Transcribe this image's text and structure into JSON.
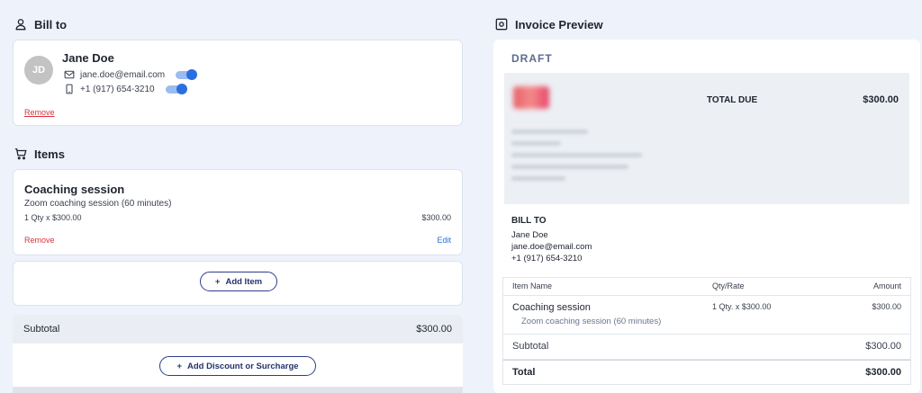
{
  "bill_to": {
    "heading": "Bill to",
    "customer": {
      "initials": "JD",
      "name": "Jane Doe",
      "email": "jane.doe@email.com",
      "phone": "+1 (917) 654-3210",
      "email_toggle_on": true,
      "phone_toggle_on": true
    },
    "remove_label": "Remove"
  },
  "items": {
    "heading": "Items",
    "list": [
      {
        "title": "Coaching session",
        "description": "Zoom coaching session (60 minutes)",
        "qty_rate": "1 Qty x $300.00",
        "amount": "$300.00",
        "remove_label": "Remove",
        "edit_label": "Edit"
      }
    ],
    "add_item_label": "Add Item"
  },
  "totals": {
    "subtotal_label": "Subtotal",
    "subtotal_value": "$300.00",
    "add_discount_label": "Add Discount or Surcharge"
  },
  "preview": {
    "heading": "Invoice Preview",
    "status": "DRAFT",
    "total_due_label": "TOTAL DUE",
    "total_due_value": "$300.00",
    "bill_to_label": "BILL TO",
    "bill_to_name": "Jane Doe",
    "bill_to_email": "jane.doe@email.com",
    "bill_to_phone": "+1 (917) 654-3210",
    "table": {
      "headers": {
        "item": "Item Name",
        "qty": "Qty/Rate",
        "amount": "Amount"
      },
      "rows": [
        {
          "name": "Coaching session",
          "description": "Zoom coaching session (60 minutes)",
          "qty_rate": "1 Qty. x $300.00",
          "amount": "$300.00"
        }
      ],
      "subtotal_label": "Subtotal",
      "subtotal_value": "$300.00",
      "total_label": "Total",
      "total_value": "$300.00"
    }
  },
  "colors": {
    "accent": "#2a6fe0",
    "danger": "#d6333c",
    "button_outline": "#2d3d8a"
  }
}
